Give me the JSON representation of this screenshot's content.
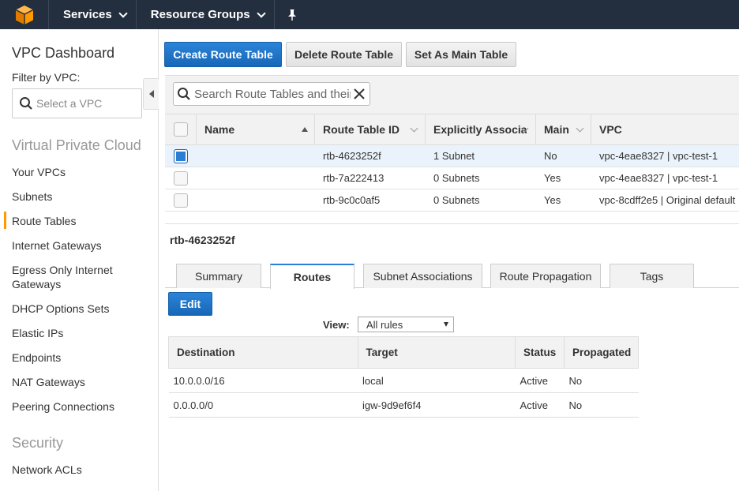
{
  "topnav": {
    "services_label": "Services",
    "resource_groups_label": "Resource Groups"
  },
  "sidebar": {
    "title": "VPC Dashboard",
    "filter_label": "Filter by VPC:",
    "filter_placeholder": "Select a VPC",
    "sections": {
      "vpc": "Virtual Private Cloud",
      "security": "Security"
    },
    "items": [
      "Your VPCs",
      "Subnets",
      "Route Tables",
      "Internet Gateways",
      "Egress Only Internet Gateways",
      "DHCP Options Sets",
      "Elastic IPs",
      "Endpoints",
      "NAT Gateways",
      "Peering Connections",
      "Network ACLs"
    ],
    "active_item": "Route Tables"
  },
  "toolbar": {
    "create_label": "Create Route Table",
    "delete_label": "Delete Route Table",
    "set_main_label": "Set As Main Table"
  },
  "search": {
    "placeholder": "Search Route Tables and their proper"
  },
  "grid": {
    "columns": [
      "Name",
      "Route Table ID",
      "Explicitly Associat",
      "Main",
      "VPC"
    ],
    "rows": [
      {
        "selected": true,
        "name": "",
        "id": "rtb-4623252f",
        "assoc": "1 Subnet",
        "main": "No",
        "vpc": "vpc-4eae8327 | vpc-test-1"
      },
      {
        "selected": false,
        "name": "",
        "id": "rtb-7a222413",
        "assoc": "0 Subnets",
        "main": "Yes",
        "vpc": "vpc-4eae8327 | vpc-test-1"
      },
      {
        "selected": false,
        "name": "",
        "id": "rtb-9c0c0af5",
        "assoc": "0 Subnets",
        "main": "Yes",
        "vpc": "vpc-8cdff2e5 | Original default"
      }
    ]
  },
  "detail": {
    "title": "rtb-4623252f",
    "tabs": [
      "Summary",
      "Routes",
      "Subnet Associations",
      "Route Propagation",
      "Tags"
    ],
    "active_tab": "Routes",
    "edit_label": "Edit",
    "view_label": "View:",
    "view_value": "All rules",
    "routes_columns": [
      "Destination",
      "Target",
      "Status",
      "Propagated"
    ],
    "routes": [
      {
        "destination": "10.0.0.0/16",
        "target": "local",
        "status": "Active",
        "propagated": "No"
      },
      {
        "destination": "0.0.0.0/0",
        "target": "igw-9d9ef6f4",
        "status": "Active",
        "propagated": "No"
      }
    ]
  },
  "colors": {
    "nav_bg": "#232f3e",
    "brand_orange": "#ff9900",
    "primary_blue": "#2a7fd4",
    "status_green": "#2a9c2a"
  }
}
